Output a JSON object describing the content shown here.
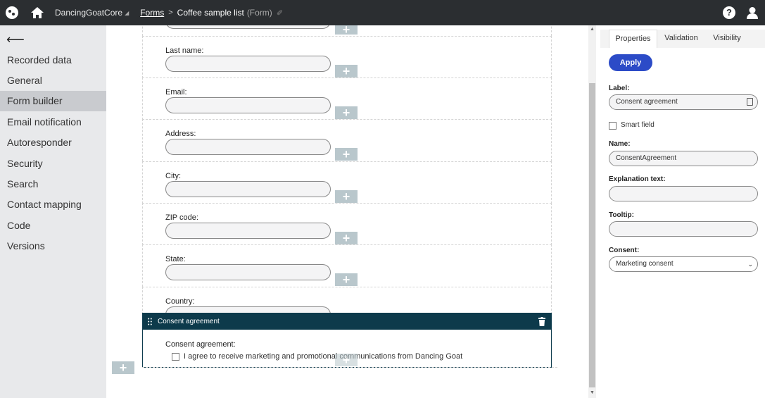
{
  "topbar": {
    "site_name": "DancingGoatCore",
    "breadcrumb_link": "Forms",
    "breadcrumb_current": "Coffee sample list",
    "breadcrumb_type": "(Form)",
    "help_glyph": "?"
  },
  "leftnav": {
    "items": [
      {
        "label": "Recorded data"
      },
      {
        "label": "General"
      },
      {
        "label": "Form builder",
        "active": true
      },
      {
        "label": "Email notification"
      },
      {
        "label": "Autoresponder"
      },
      {
        "label": "Security"
      },
      {
        "label": "Search"
      },
      {
        "label": "Contact mapping"
      },
      {
        "label": "Code"
      },
      {
        "label": "Versions"
      }
    ]
  },
  "form": {
    "fields": [
      {
        "label": "Last name:"
      },
      {
        "label": "Email:"
      },
      {
        "label": "Address:"
      },
      {
        "label": "City:"
      },
      {
        "label": "ZIP code:"
      },
      {
        "label": "State:"
      },
      {
        "label": "Country:"
      }
    ],
    "consent": {
      "header": "Consent agreement",
      "label": "Consent agreement:",
      "text": "I agree to receive marketing and promotional communications from Dancing Goat"
    }
  },
  "panel": {
    "tabs": [
      "Properties",
      "Validation",
      "Visibility"
    ],
    "apply_label": "Apply",
    "label_label": "Label:",
    "label_value": "Consent agreement",
    "smart_field_label": "Smart field",
    "name_label": "Name:",
    "name_value": "ConsentAgreement",
    "explanation_label": "Explanation text:",
    "tooltip_label": "Tooltip:",
    "consent_label": "Consent:",
    "consent_value": "Marketing consent"
  },
  "colors": {
    "topbar": "#2b2e31",
    "consent_header": "#0d3a4b",
    "apply": "#2c4bc7"
  }
}
